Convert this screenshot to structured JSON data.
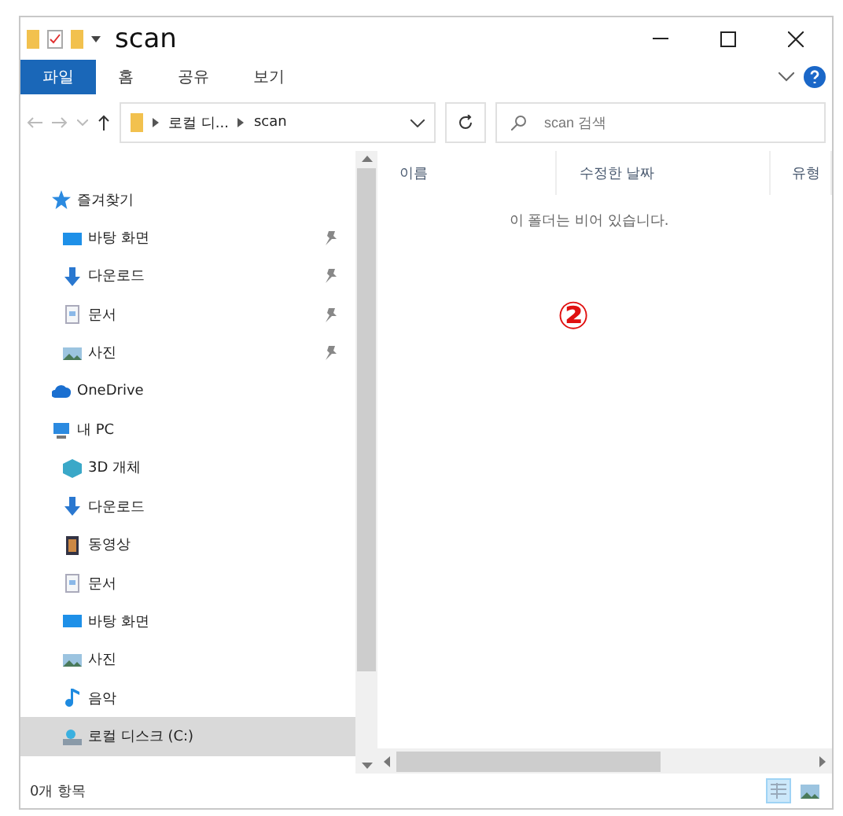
{
  "window": {
    "title": "scan"
  },
  "ribbon": {
    "tabs": [
      {
        "label": "파일",
        "selected": true
      },
      {
        "label": "홈",
        "selected": false
      },
      {
        "label": "공유",
        "selected": false
      },
      {
        "label": "보기",
        "selected": false
      }
    ]
  },
  "address": {
    "path": [
      "로컬 디...",
      "scan"
    ]
  },
  "search": {
    "placeholder": "scan 검색"
  },
  "nav": [
    {
      "label": "즐겨찾기",
      "kind": "star",
      "selected": false,
      "children": [
        {
          "label": "바탕 화면",
          "kind": "desktop",
          "pinned": true,
          "selected": false
        },
        {
          "label": "다운로드",
          "kind": "download",
          "pinned": true,
          "selected": false
        },
        {
          "label": "문서",
          "kind": "document",
          "pinned": true,
          "selected": false
        },
        {
          "label": "사진",
          "kind": "picture",
          "pinned": true,
          "selected": false
        }
      ]
    },
    {
      "label": "OneDrive",
      "kind": "cloud",
      "selected": false
    },
    {
      "label": "내 PC",
      "kind": "pc",
      "selected": false,
      "children": [
        {
          "label": "3D 개체",
          "kind": "cube",
          "selected": false
        },
        {
          "label": "다운로드",
          "kind": "download",
          "selected": false
        },
        {
          "label": "동영상",
          "kind": "video",
          "selected": false
        },
        {
          "label": "문서",
          "kind": "document",
          "selected": false
        },
        {
          "label": "바탕 화면",
          "kind": "desktop",
          "selected": false
        },
        {
          "label": "사진",
          "kind": "picture",
          "selected": false
        },
        {
          "label": "음악",
          "kind": "music",
          "selected": false
        },
        {
          "label": "로컬 디스크 (C:)",
          "kind": "disk",
          "selected": true
        }
      ]
    }
  ],
  "columns": [
    "이름",
    "수정한 날짜",
    "유형"
  ],
  "empty_message": "이 폴더는 비어 있습니다.",
  "annotation": "②",
  "status_bar": {
    "item_count": "0개 항목"
  },
  "view_buttons": [
    {
      "kind": "details",
      "selected": true
    },
    {
      "kind": "large-icons",
      "selected": false
    }
  ]
}
